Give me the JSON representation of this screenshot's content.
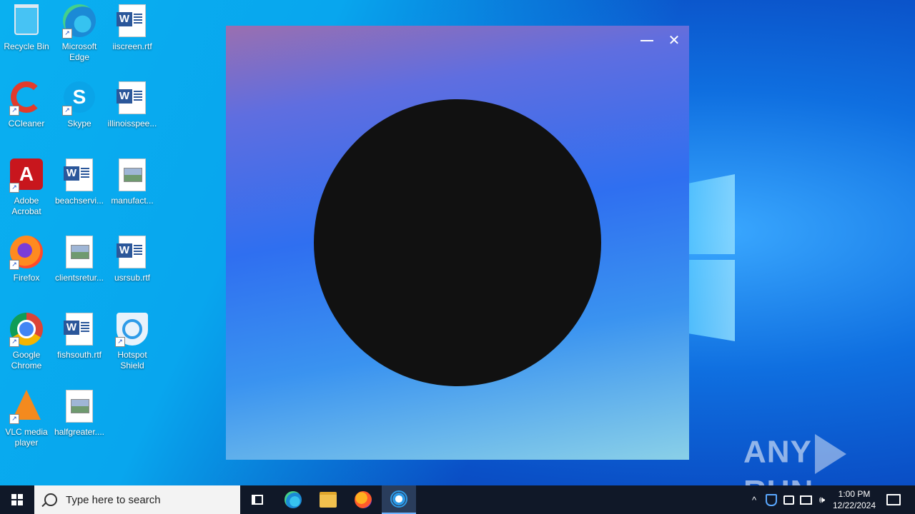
{
  "desktop": {
    "icons": [
      {
        "label": "Recycle Bin"
      },
      {
        "label": "Microsoft Edge"
      },
      {
        "label": "iiscreen.rtf"
      },
      {
        "label": "CCleaner"
      },
      {
        "label": "Skype"
      },
      {
        "label": "illinoisspee..."
      },
      {
        "label": "Adobe Acrobat"
      },
      {
        "label": "beachservi..."
      },
      {
        "label": "manufact..."
      },
      {
        "label": "Firefox"
      },
      {
        "label": "clientsretur..."
      },
      {
        "label": "usrsub.rtf"
      },
      {
        "label": "Google Chrome"
      },
      {
        "label": "fishsouth.rtf"
      },
      {
        "label": "Hotspot Shield"
      },
      {
        "label": "VLC media player"
      },
      {
        "label": "halfgreater...."
      }
    ]
  },
  "app_window": {
    "minimize_glyph": "—",
    "close_glyph": "✕"
  },
  "watermark": {
    "left": "ANY",
    "right": "RUN"
  },
  "taskbar": {
    "search_placeholder": "Type here to search",
    "clock_time": "1:00 PM",
    "clock_date": "12/22/2024",
    "tray_chevron": "^",
    "volume_glyph": "🕪"
  },
  "colors": {
    "taskbar": "#101828",
    "circle": "#111111",
    "desktop_accent": "#0a4fc6"
  }
}
